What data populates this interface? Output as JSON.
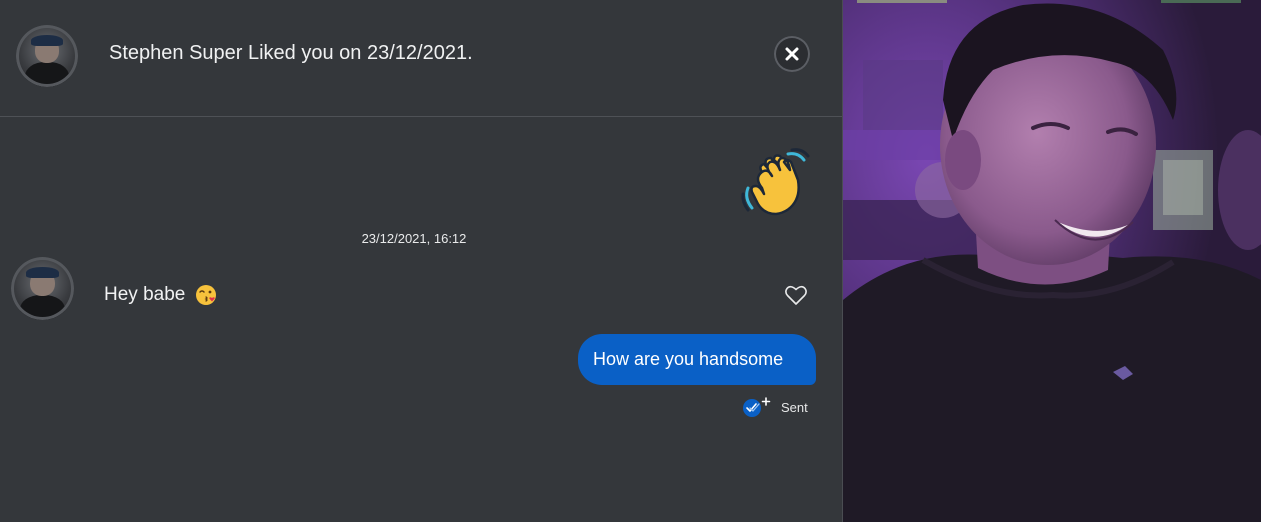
{
  "header": {
    "title": "Stephen Super Liked you on 23/12/2021."
  },
  "conversation": {
    "timestamp": "23/12/2021, 16:12",
    "incoming_message": {
      "text": "Hey babe",
      "emoji": "kissing-wink-emoji"
    },
    "outgoing_message": {
      "text": "How are you handsome",
      "status": "Sent"
    }
  },
  "icons": {
    "close": "close-icon",
    "wave": "waving-hand-icon",
    "heart": "heart-outline-icon",
    "read_receipt": "delivered-check-icon"
  },
  "colors": {
    "background": "#34373b",
    "outgoing_bubble": "#0a60c6",
    "text": "#f0f1f2"
  }
}
